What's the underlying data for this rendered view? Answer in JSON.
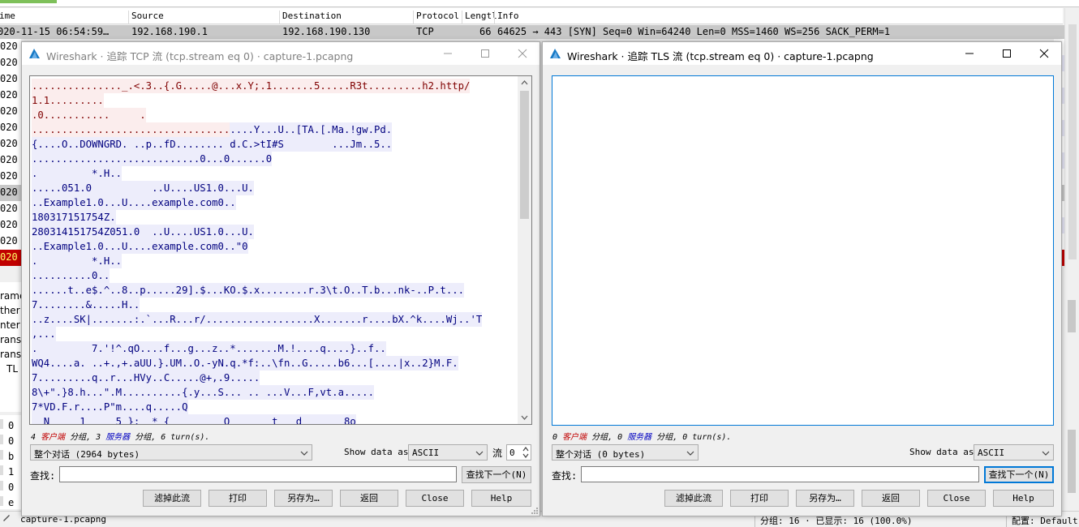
{
  "background": {
    "columns": [
      "ime",
      "Source",
      "Destination",
      "Protocol",
      "Lengtl",
      "Info"
    ],
    "row1": {
      "time": "020-11-15 06:54:59…",
      "source": "192.168.190.1",
      "destination": "192.168.190.130",
      "protocol": "TCP",
      "length": "66",
      "info": "64625 → 443 [SYN] Seq=0 Win=64240 Len=0 MSS=1460 WS=256 SACK_PERM=1"
    },
    "left_rows": [
      "020",
      "020",
      "020",
      "020",
      "020",
      "020",
      "020",
      "020",
      "020",
      "020",
      "020",
      "020",
      "020",
      "020"
    ],
    "tree_items": [
      "rame",
      "ther",
      "nter",
      "rans",
      "rans",
      "TL"
    ],
    "hex_items": [
      "0",
      "0",
      "b",
      "1",
      "0",
      "e"
    ],
    "status": {
      "file": "capture-1.pcapng",
      "packets": "分组: 16 · 已显示: 16 (100.0%)",
      "profile": "配置: Default"
    }
  },
  "tcp_dialog": {
    "title": "Wireshark · 追踪 TCP 流 (tcp.stream eq 0) · capture-1.pcapng",
    "lines": [
      {
        "t": "..............._.<.3..{.G.....@...x.Y;.1.......5.....R3t.........h2.http/",
        "k": "c"
      },
      {
        "t": "1.1.........",
        "k": "c"
      },
      {
        "t": ".0...........     .",
        "k": "c"
      },
      {
        "t": ".................................",
        "k": "c",
        "cont": "....Y...U..[TA.[.Ma.!gw.Pd."
      },
      {
        "t": "{....O..DOWNGRD. ..p..fD........ d.C.>tI#S        ...Jm..5..",
        "k": "s"
      },
      {
        "t": "............................0...0......0",
        "k": "s"
      },
      {
        "t": ".         *.H..",
        "k": "s"
      },
      {
        "t": ".....051.0          ..U....US1.0...U.",
        "k": "s"
      },
      {
        "t": "..Example1.0...U....example.com0..",
        "k": "s"
      },
      {
        "t": "180317151754Z.",
        "k": "s"
      },
      {
        "t": "280314151754Z051.0  ..U....US1.0...U.",
        "k": "s"
      },
      {
        "t": "..Example1.0...U....example.com0..\"0",
        "k": "s"
      },
      {
        "t": ".         *.H..",
        "k": "s"
      },
      {
        "t": "..........0..",
        "k": "s"
      },
      {
        "t": "......t..e$.^..8..p.....29].$...KO.$.x........r.3\\t.O..T.b...nk-..P.t...",
        "k": "s"
      },
      {
        "t": "7........&.....H..",
        "k": "s"
      },
      {
        "t": "..z....SK|.......:.`...R...r/..................X.......r....bX.^k....Wj..'T",
        "k": "s"
      },
      {
        "t": ",...",
        "k": "s"
      },
      {
        "t": ".         7.'!^.qO....f...g...z..*.......M.!....q....}..f..",
        "k": "s"
      },
      {
        "t": "WQ4....a. ..+.,+.aUU.}.UM..O.-yN.q.*f:..\\fn..G.....b6...[....|x..2}M.F.",
        "k": "s"
      },
      {
        "t": "7.........q..r...HVy..C.....@+,.9.....",
        "k": "s"
      },
      {
        "t": "8\\+\".}8.h...\".M..........{.y...S... .. ...V...F,vt.a.....",
        "k": "s"
      },
      {
        "t": "7*VD.F.r....P\"m....q.....Q",
        "k": "s"
      },
      {
        "t": "  N     1     5 }:  * {         O       t   d       8o",
        "k": "s"
      }
    ],
    "summary": {
      "clients": "4",
      "client_word": "客户端",
      "sep1": " 分组, ",
      "servers": "3",
      "server_word": "服务器",
      "rest": " 分组, 6 turn(s)."
    },
    "conversation_select": "整个对话 (2964 bytes)",
    "show_data_label": "Show data as",
    "show_data_value": "ASCII",
    "stream_label": "流",
    "stream_value": "0",
    "find_label": "查找:",
    "find_next": "查找下一个(N)",
    "buttons": {
      "filter_out": "滤掉此流",
      "print": "打印",
      "save_as": "另存为…",
      "back": "返回",
      "close": "Close",
      "help": "Help"
    }
  },
  "tls_dialog": {
    "title": "Wireshark · 追踪 TLS 流 (tcp.stream eq 0) · capture-1.pcapng",
    "summary": {
      "clients": "0",
      "client_word": "客户端",
      "sep1": " 分组, ",
      "servers": "0",
      "server_word": "服务器",
      "rest": " 分组, 0 turn(s)."
    },
    "conversation_select": "整个对话 (0 bytes)",
    "show_data_label": "Show data as",
    "show_data_value": "ASCII",
    "find_label": "查找:",
    "find_next": "查找下一个(N)",
    "buttons": {
      "filter_out": "滤掉此流",
      "print": "打印",
      "save_as": "另存为…",
      "back": "返回",
      "close": "Close",
      "help": "Help"
    }
  },
  "colors": {
    "client_bg": "#fbeded",
    "client_fg": "#7f0000",
    "server_bg": "#ededfb",
    "server_fg": "#00007f",
    "focus_accent": "#0078d7",
    "selected_row": "#c00000"
  }
}
